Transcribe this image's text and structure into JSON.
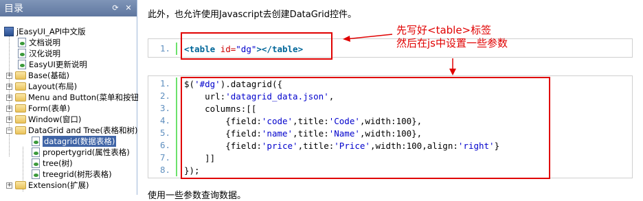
{
  "toc": {
    "title": "目录",
    "items": [
      {
        "label": "jEasyUI_API中文版"
      },
      {
        "label": "文档说明"
      },
      {
        "label": "汉化说明"
      },
      {
        "label": "EasyUI更新说明"
      },
      {
        "label": "Base(基础)"
      },
      {
        "label": "Layout(布局)"
      },
      {
        "label": "Menu and Button(菜单和按钮)"
      },
      {
        "label": "Form(表单)"
      },
      {
        "label": "Window(窗口)"
      },
      {
        "label": "DataGrid and Tree(表格和树)"
      },
      {
        "label": "datagrid(数据表格)"
      },
      {
        "label": "propertygrid(属性表格)"
      },
      {
        "label": "tree(树)"
      },
      {
        "label": "treegrid(树形表格)"
      },
      {
        "label": "Extension(扩展)"
      }
    ]
  },
  "content": {
    "intro": "此外，也允许使用Javascript去创建DataGrid控件。",
    "snippet1": {
      "line_numbers": [
        "1."
      ],
      "tag_open": "<table ",
      "attr_name": "id=",
      "attr_value": "\"dg\"",
      "tag_close": "></table>"
    },
    "snippet2": {
      "line_numbers": [
        "1.",
        "2.",
        "3.",
        "4.",
        "5.",
        "6.",
        "7.",
        "8."
      ],
      "lines": [
        [
          "$(",
          "'#dg'",
          ").datagrid({"
        ],
        [
          "    url:",
          "'datagrid_data.json'",
          ","
        ],
        [
          "    columns:[["
        ],
        [
          "        {field:",
          "'code'",
          ",title:",
          "'Code'",
          ",width:100},"
        ],
        [
          "        {field:",
          "'name'",
          ",title:",
          "'Name'",
          ",width:100},"
        ],
        [
          "        {field:",
          "'price'",
          ",title:",
          "'Price'",
          ",width:100,align:",
          "'right'",
          "}"
        ],
        [
          "    ]]"
        ],
        [
          "});"
        ]
      ]
    },
    "outro": "使用一些参数查询数据。",
    "annotation": [
      "先写好<table>标签",
      "然后在js中设置一些参数"
    ],
    "annotation_color": "#e00000"
  }
}
